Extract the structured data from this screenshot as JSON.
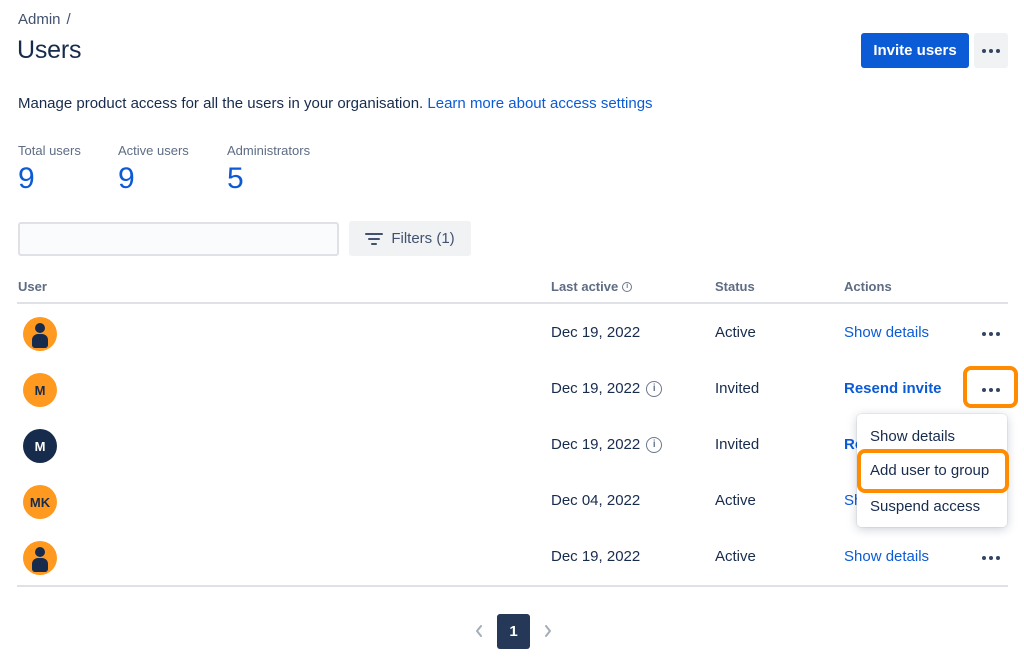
{
  "breadcrumb": {
    "root": "Admin",
    "separator": "/"
  },
  "page": {
    "title": "Users"
  },
  "header": {
    "invite_label": "Invite users"
  },
  "description": {
    "text": "Manage product access for all the users in your organisation.",
    "link": "Learn more about access settings"
  },
  "stats": [
    {
      "label": "Total users",
      "value": "9"
    },
    {
      "label": "Active users",
      "value": "9"
    },
    {
      "label": "Administrators",
      "value": "5"
    }
  ],
  "search": {
    "placeholder": ""
  },
  "filters": {
    "label": "Filters (1)"
  },
  "table": {
    "columns": {
      "user": "User",
      "last_active": "Last active",
      "status": "Status",
      "actions": "Actions"
    },
    "rows": [
      {
        "avatar": "",
        "avatar_color": "#ff991f",
        "last_active": "Dec 19, 2022",
        "status": "Active",
        "action": "Show details"
      },
      {
        "avatar": "M",
        "avatar_color": "#ff991f",
        "last_active": "Dec 19, 2022",
        "status": "Invited",
        "action": "Resend invite"
      },
      {
        "avatar": "M",
        "avatar_color": "#172b4d",
        "last_active": "Dec 19, 2022",
        "status": "Invited",
        "action": "Re"
      },
      {
        "avatar": "MK",
        "avatar_color": "#ff991f",
        "last_active": "Dec 04, 2022",
        "status": "Active",
        "action": "Sh"
      },
      {
        "avatar": "",
        "avatar_color": "#ff991f",
        "last_active": "Dec 19, 2022",
        "status": "Active",
        "action": "Show details"
      }
    ]
  },
  "row_menu": {
    "items": [
      "Show details",
      "Add user to group",
      "Suspend access"
    ]
  },
  "pagination": {
    "current": "1"
  },
  "colors": {
    "accent": "#0c5bd6",
    "highlight": "#ff8b00",
    "text": "#172b4d"
  }
}
